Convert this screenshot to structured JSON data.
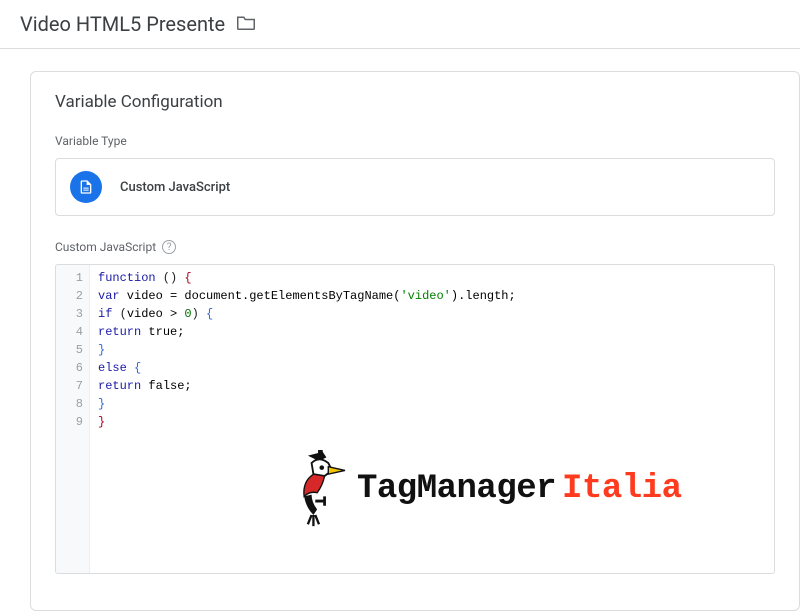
{
  "header": {
    "title": "Video HTML5 Presente"
  },
  "panel": {
    "title": "Variable Configuration"
  },
  "variableType": {
    "label": "Variable Type",
    "name": "Custom JavaScript"
  },
  "codeEditor": {
    "label": "Custom JavaScript",
    "lines": [
      "1",
      "2",
      "3",
      "4",
      "5",
      "6",
      "7",
      "8",
      "9"
    ],
    "code": {
      "l1": {
        "kw": "function",
        "rest": " () ",
        "brace": "{"
      },
      "l2": {
        "kw": "var",
        "id": " video = document.getElementsByTagName(",
        "str": "'video'",
        "rest": ").length;"
      },
      "l3": {
        "kw": "if",
        "open": " (",
        "id": "video > ",
        "num": "0",
        "close": ") ",
        "brace": "{"
      },
      "l4": {
        "kw": "return",
        "val": " true;"
      },
      "l5": {
        "brace": "}"
      },
      "l6": {
        "kw": "else",
        "sp": " ",
        "brace": "{"
      },
      "l7": {
        "kw": "return",
        "val": " false;"
      },
      "l8": {
        "brace": "}"
      },
      "l9": {
        "brace": "}"
      }
    }
  },
  "watermark": {
    "part1": "TagManager",
    "part2": "Italia"
  }
}
